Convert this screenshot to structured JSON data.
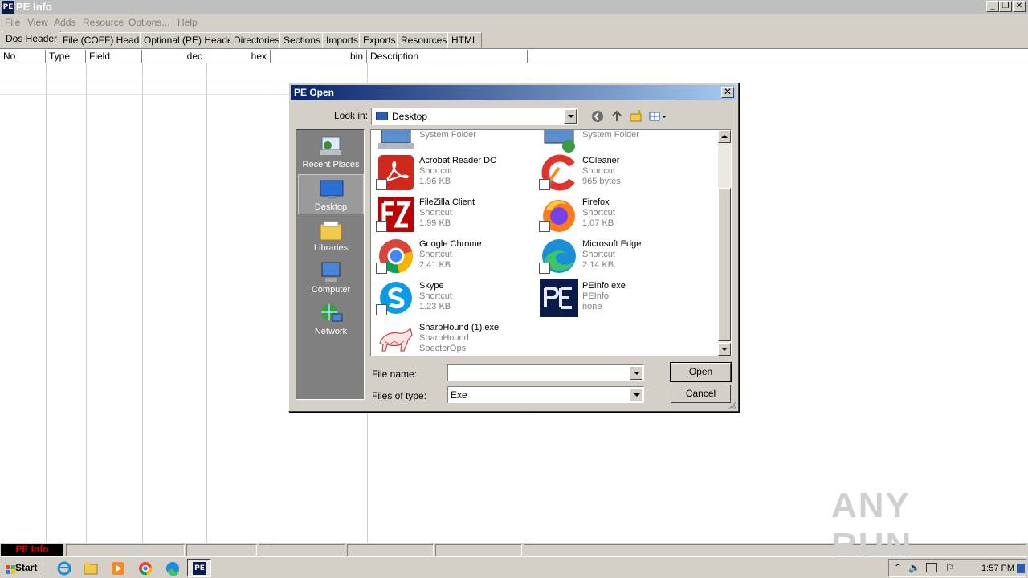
{
  "window": {
    "title": "PE Info",
    "app_icon_text": "PE",
    "caption_buttons": [
      "_",
      "❐",
      "✕"
    ]
  },
  "menu": [
    "File",
    "View",
    "Adds",
    "Resource",
    "Options...",
    "Help"
  ],
  "tabs": [
    "Dos Header",
    "File (COFF) Header",
    "Optional (PE) Header",
    "Directories",
    "Sections",
    "Imports",
    "Exports",
    "Resources",
    "HTML"
  ],
  "active_tab": "Dos Header",
  "table": {
    "columns": [
      "No",
      "Type",
      "Field",
      "dec",
      "hex",
      "bin",
      "Description"
    ]
  },
  "statusbar": {
    "name": "PE Info"
  },
  "dialog": {
    "title": "PE Open",
    "close": "✕",
    "look_in_label": "Look in:",
    "look_in_value": "Desktop",
    "places": [
      "Recent Places",
      "Desktop",
      "Libraries",
      "Computer",
      "Network"
    ],
    "selected_place": "Desktop",
    "partial_items": [
      {
        "type": "System Folder"
      },
      {
        "type": "System Folder"
      }
    ],
    "files": [
      {
        "name": "Acrobat Reader DC",
        "type": "Shortcut",
        "size": "1.96 KB",
        "icon": "acrobat-icon"
      },
      {
        "name": "CCleaner",
        "type": "Shortcut",
        "size": "965 bytes",
        "icon": "ccleaner-icon"
      },
      {
        "name": "FileZilla Client",
        "type": "Shortcut",
        "size": "1.99 KB",
        "icon": "filezilla-icon"
      },
      {
        "name": "Firefox",
        "type": "Shortcut",
        "size": "1.07 KB",
        "icon": "firefox-icon"
      },
      {
        "name": "Google Chrome",
        "type": "Shortcut",
        "size": "2.41 KB",
        "icon": "chrome-icon"
      },
      {
        "name": "Microsoft Edge",
        "type": "Shortcut",
        "size": "2.14 KB",
        "icon": "edge-icon"
      },
      {
        "name": "Skype",
        "type": "Shortcut",
        "size": "1.23 KB",
        "icon": "skype-icon"
      },
      {
        "name": "PEInfo.exe",
        "type": "PEInfo",
        "size": "none",
        "icon": "peinfo-icon"
      },
      {
        "name": "SharpHound (1).exe",
        "type": "SharpHound",
        "size": "SpecterOps",
        "icon": "sharphound-icon"
      }
    ],
    "file_name_label": "File name:",
    "file_name_value": "",
    "files_of_type_label": "Files of type:",
    "files_of_type_value": "Exe",
    "open_label": "Open",
    "cancel_label": "Cancel"
  },
  "taskbar": {
    "start_label": "Start",
    "clock": "1:57 PM"
  },
  "watermark": "ANY RUN"
}
